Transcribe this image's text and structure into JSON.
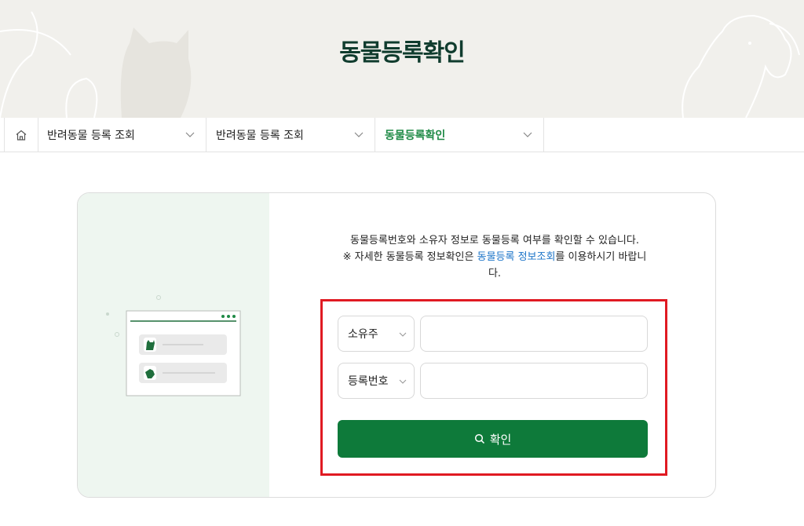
{
  "header": {
    "title": "동물등록확인"
  },
  "breadcrumb": {
    "home_icon": "home-icon",
    "items": [
      {
        "label": "반려동물 등록 조회"
      },
      {
        "label": "반려동물 등록 조회"
      },
      {
        "label": "동물등록확인",
        "active": true
      }
    ]
  },
  "intro": {
    "line1": "동물등록번호와 소유자 정보로 동물등록 여부를 확인할 수 있습니다.",
    "note_prefix": "※ 자세한 동물등록 정보확인은 ",
    "note_link": "동물등록 정보조회",
    "note_suffix": "를 이용하시기 바랍니다."
  },
  "form": {
    "owner_select": {
      "selected": "소유주"
    },
    "owner_input": {
      "value": ""
    },
    "reg_select": {
      "selected": "등록번호"
    },
    "reg_input": {
      "value": ""
    },
    "confirm_label": "확인"
  },
  "colors": {
    "brand_green": "#0e7a3a",
    "active_nav": "#1f8a46",
    "highlight_red": "#e01a22"
  }
}
